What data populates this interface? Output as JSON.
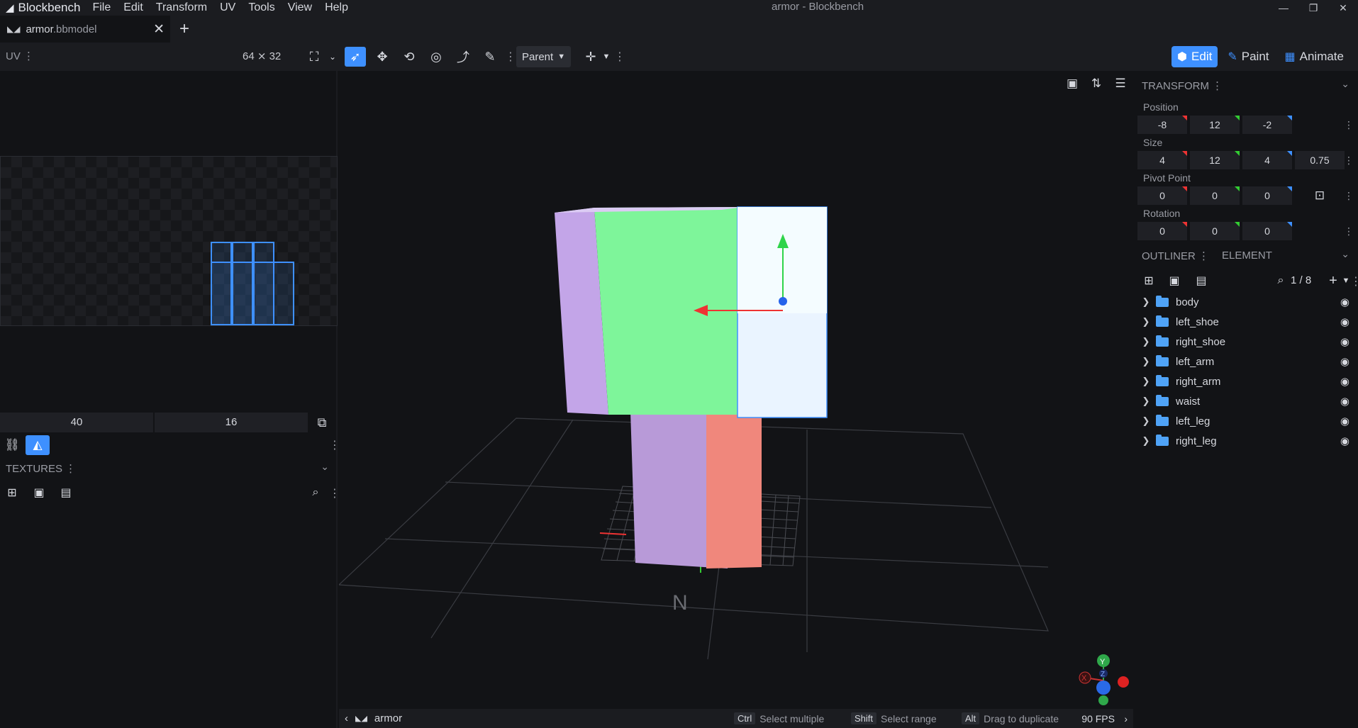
{
  "app": {
    "name": "Blockbench",
    "window_title": "armor - Blockbench",
    "menu": [
      "File",
      "Edit",
      "Transform",
      "UV",
      "Tools",
      "View",
      "Help"
    ]
  },
  "tab": {
    "name": "armor",
    "ext": ".bbmodel"
  },
  "toolbar": {
    "uv_label": "UV",
    "texture_size": "64 ⨯ 32",
    "parent_label": "Parent",
    "modes": [
      {
        "label": "Edit",
        "icon": "cube-icon",
        "active": true
      },
      {
        "label": "Paint",
        "icon": "brush-icon",
        "active": false
      },
      {
        "label": "Animate",
        "icon": "film-icon",
        "active": false
      }
    ]
  },
  "uv_editor": {
    "value_x": "40",
    "value_y": "16"
  },
  "textures": {
    "title": "TEXTURES"
  },
  "transform": {
    "title": "TRANSFORM",
    "position_label": "Position",
    "position": [
      "-8",
      "12",
      "-2"
    ],
    "size_label": "Size",
    "size": [
      "4",
      "12",
      "4"
    ],
    "inflate": "0.75",
    "pivot_label": "Pivot Point",
    "pivot": [
      "0",
      "0",
      "0"
    ],
    "rotation_label": "Rotation",
    "rotation": [
      "0",
      "0",
      "0"
    ]
  },
  "outliner": {
    "title": "OUTLINER",
    "tab2": "ELEMENT",
    "count": "1 / 8",
    "items": [
      {
        "name": "body"
      },
      {
        "name": "left_shoe"
      },
      {
        "name": "right_shoe"
      },
      {
        "name": "left_arm"
      },
      {
        "name": "right_arm"
      },
      {
        "name": "waist"
      },
      {
        "name": "left_leg"
      },
      {
        "name": "right_leg"
      }
    ]
  },
  "statusbar": {
    "project": "armor",
    "hints": [
      {
        "key": "Ctrl",
        "text": "Select multiple"
      },
      {
        "key": "Shift",
        "text": "Select range"
      },
      {
        "key": "Alt",
        "text": "Drag to duplicate"
      }
    ],
    "fps": "90 FPS"
  },
  "gizmo": {
    "y": "Y",
    "x": "X",
    "z": "Z"
  },
  "colors": {
    "accent": "#3e90ff",
    "cube_purple": "#c3a5e8",
    "cube_green": "#7ef59a",
    "cube_red": "#f08a80",
    "cube_white": "#f2fbff"
  }
}
